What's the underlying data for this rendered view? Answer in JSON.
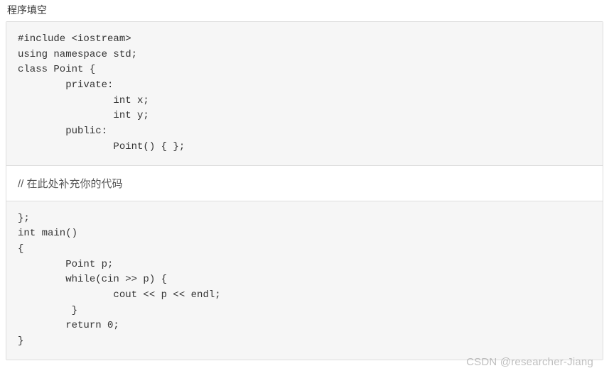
{
  "title": "程序填空",
  "code_top": "#include <iostream>\nusing namespace std;\nclass Point {\n        private:\n                int x;\n                int y;\n        public:\n                Point() { };",
  "fill_comment": "// 在此处补充你的代码",
  "code_bottom": "};\nint main()\n{\n        Point p;\n        while(cin >> p) {\n                cout << p << endl;\n         }\n        return 0;\n}",
  "watermark": "CSDN @researcher-Jiang"
}
